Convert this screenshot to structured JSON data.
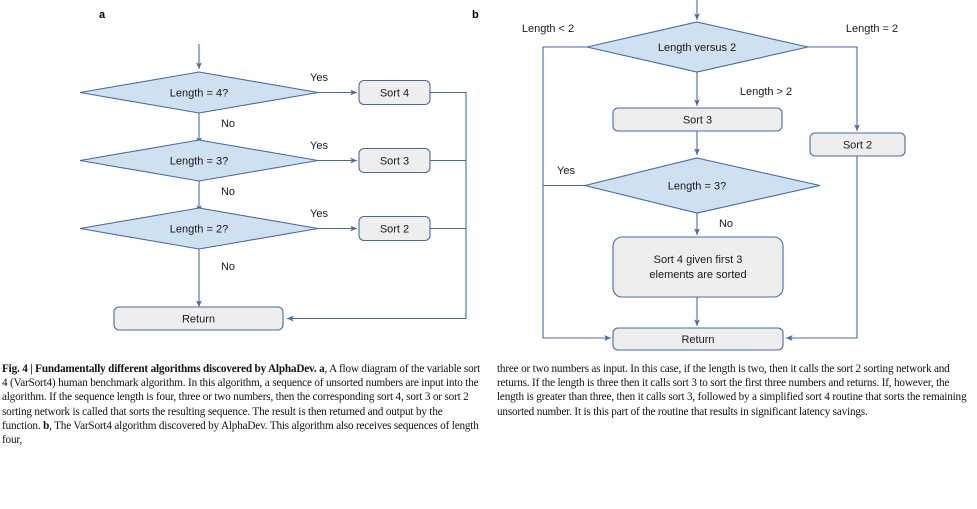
{
  "figure": {
    "panel_a": {
      "label": "a",
      "nodes": [
        {
          "id": "a-d1",
          "kind": "decision",
          "text": "Length = 4?"
        },
        {
          "id": "a-d2",
          "kind": "decision",
          "text": "Length = 3?"
        },
        {
          "id": "a-d3",
          "kind": "decision",
          "text": "Length = 2?"
        },
        {
          "id": "a-p1",
          "kind": "process",
          "text": "Sort 4"
        },
        {
          "id": "a-p2",
          "kind": "process",
          "text": "Sort 3"
        },
        {
          "id": "a-p3",
          "kind": "process",
          "text": "Sort 2"
        },
        {
          "id": "a-ret",
          "kind": "process",
          "text": "Return"
        }
      ],
      "edge_labels": {
        "yes1": "Yes",
        "yes2": "Yes",
        "yes3": "Yes",
        "no1": "No",
        "no2": "No",
        "no3": "No"
      }
    },
    "panel_b": {
      "label": "b",
      "nodes": [
        {
          "id": "b-d1",
          "kind": "decision",
          "text": "Length versus 2"
        },
        {
          "id": "b-p1",
          "kind": "process",
          "text": "Sort 3"
        },
        {
          "id": "b-p2",
          "kind": "process",
          "text": "Sort 2"
        },
        {
          "id": "b-d2",
          "kind": "decision",
          "text": "Length = 3?"
        },
        {
          "id": "b-p3",
          "kind": "process",
          "text_line1": "Sort 4 given first 3",
          "text_line2": "elements are sorted"
        },
        {
          "id": "b-ret",
          "kind": "process",
          "text": "Return"
        }
      ],
      "edge_labels": {
        "lt2": "Length < 2",
        "eq2": "Length = 2",
        "gt2": "Length > 2",
        "yes": "Yes",
        "no": "No"
      }
    },
    "colors": {
      "decision_fill": "#cfe0f0",
      "process_fill": "#eeeeee",
      "stroke": "#4a6aa5",
      "text": "#1a1a1a"
    }
  },
  "caption": {
    "title": "Fig. 4 | Fundamentally different algorithms discovered by AlphaDev.",
    "left_a_marker": "a",
    "left_text_1": ", A flow diagram of the variable sort 4 (VarSort4) human benchmark algorithm. In this algorithm, a sequence of unsorted numbers are input into the algorithm. If the sequence length is four, three or two numbers, then the corresponding sort 4, sort 3 or sort 2 sorting network is called that sorts the resulting sequence. The result is then returned and output by the function. ",
    "left_b_marker": "b",
    "left_text_2": ", The VarSort4 algorithm discovered by AlphaDev. This algorithm also receives sequences of length four,",
    "right_text": "three or two numbers as input. In this case, if the length is two, then it calls the sort 2 sorting network and returns. If the length is three then it calls sort 3 to sort the first three numbers and returns. If, however, the length is greater than three, then it calls sort 3, followed by a simplified sort 4 routine that sorts the remaining unsorted number. It is this part of the routine that results in significant latency savings."
  }
}
